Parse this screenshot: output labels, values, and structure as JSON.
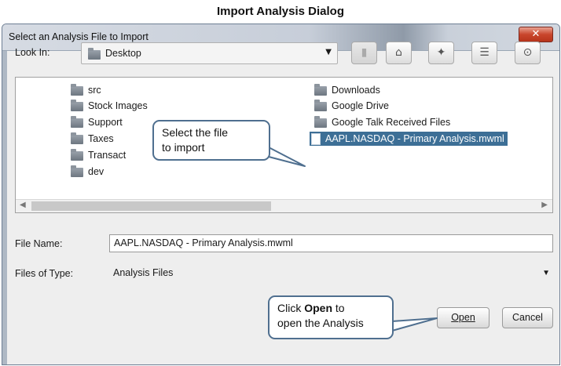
{
  "caption": "Import Analysis Dialog",
  "window": {
    "title": "Select an Analysis File to Import",
    "close_glyph": "✕"
  },
  "lookin": {
    "label": "Look In:",
    "value": "Desktop",
    "arrow": "▼"
  },
  "toolbar": [
    {
      "name": "up-folder-icon",
      "glyph": "▮"
    },
    {
      "name": "home-icon",
      "glyph": "⌂"
    },
    {
      "name": "new-folder-icon",
      "glyph": "✦"
    },
    {
      "name": "list-view-icon",
      "glyph": "☰"
    },
    {
      "name": "details-view-icon",
      "glyph": "⊙"
    }
  ],
  "files": {
    "left_column": [
      "src",
      "Stock Images",
      "Support",
      "Taxes",
      "Transact",
      "dev"
    ],
    "right_column": [
      "Downloads",
      "Google Drive",
      "Google Talk Received Files"
    ],
    "selected_file": "AAPL.NASDAQ - Primary Analysis.mwml"
  },
  "scroll": {
    "left": "◀",
    "right": "▶"
  },
  "file_name": {
    "label": "File Name:",
    "value": "AAPL.NASDAQ - Primary Analysis.mwml"
  },
  "file_type": {
    "label": "Files of Type:",
    "value": "Analysis Files",
    "arrow": "▼"
  },
  "buttons": {
    "open": "Open",
    "cancel": "Cancel"
  },
  "callouts": {
    "select": {
      "line1": "Select the file",
      "line2": "to import"
    },
    "open": {
      "pre": "Click ",
      "bold": "Open",
      "post": " to",
      "line2": "open the Analysis"
    }
  },
  "colors": {
    "selection": "#3d6f96",
    "callout_border": "#4f6f8f",
    "close_button": "#c9462c"
  }
}
